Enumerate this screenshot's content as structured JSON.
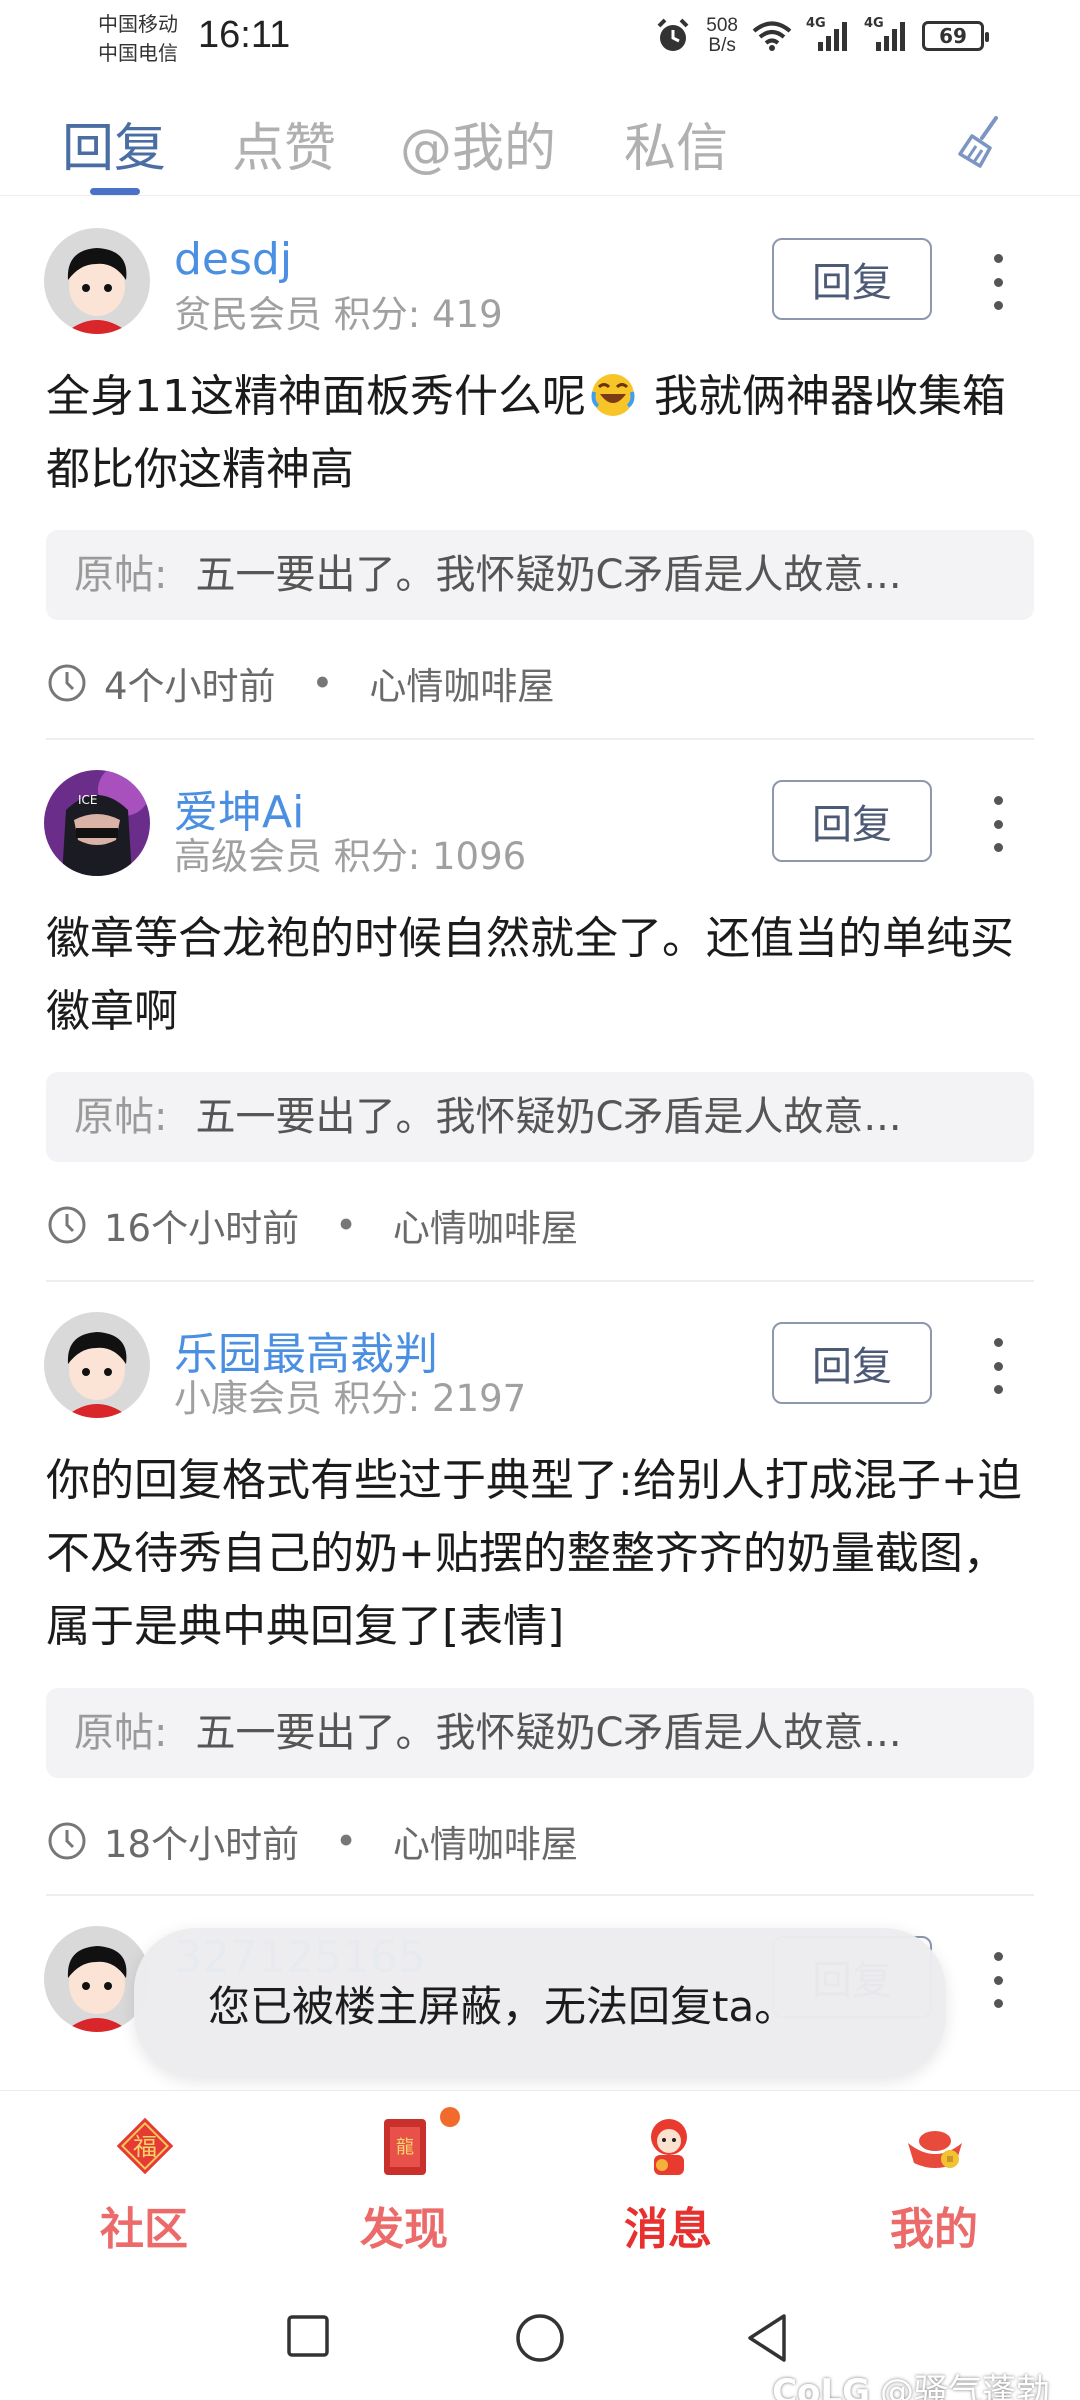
{
  "status_bar": {
    "carrier1": "中国移动",
    "carrier2": "中国电信",
    "time": "16:11",
    "net_speed_value": "508",
    "net_speed_unit": "B/s",
    "signal1_label": "4G",
    "signal2_label": "4G",
    "battery": "69"
  },
  "tabs": {
    "reply": "回复",
    "like": "点赞",
    "mention": "@我的",
    "dm": "私信",
    "active": "回复"
  },
  "messages": [
    {
      "username": "desdj",
      "level": "贫民会员 积分: 419",
      "reply_label": "回复",
      "text_before_emoji": "全身11这精神面板秀什么呢",
      "text_after_emoji": " 我就俩神器收集箱都比你这精神高",
      "original_label": "原帖:",
      "original_text": "五一要出了。我怀疑奶C矛盾是人故意...",
      "time": "4个小时前",
      "board": "心情咖啡屋"
    },
    {
      "username": "爱坤Ai",
      "level": "高级会员 积分: 1096",
      "reply_label": "回复",
      "text": "徽章等合龙袍的时候自然就全了。还值当的单纯买徽章啊",
      "original_label": "原帖:",
      "original_text": "五一要出了。我怀疑奶C矛盾是人故意...",
      "time": "16个小时前",
      "board": "心情咖啡屋"
    },
    {
      "username": "乐园最高裁判",
      "level": "小康会员 积分: 2197",
      "reply_label": "回复",
      "text": "你的回复格式有些过于典型了:给别人打成混子+迫不及待秀自己的奶+贴摆的整整齐齐的奶量截图，属于是典中典回复了[表情]",
      "original_label": "原帖:",
      "original_text": "五一要出了。我怀疑奶C矛盾是人故意...",
      "time": "18个小时前",
      "board": "心情咖啡屋"
    },
    {
      "username": "327125165",
      "reply_label": "回复"
    }
  ],
  "toast": "您已被楼主屏蔽，无法回复ta。",
  "bottom_nav": [
    {
      "label": "社区",
      "icon": "fu-icon"
    },
    {
      "label": "发现",
      "icon": "scroll-icon"
    },
    {
      "label": "消息",
      "icon": "mascot-icon"
    },
    {
      "label": "我的",
      "icon": "gold-ingot-icon"
    }
  ],
  "active_nav": "消息",
  "watermark_logo": "CoLG",
  "watermark_text": "@骚气蓬勃",
  "colors": {
    "accent_blue": "#4a73c7",
    "username_blue": "#4a8fe2",
    "nav_red": "#e8312f",
    "nav_red_light": "#ec6a6a"
  }
}
